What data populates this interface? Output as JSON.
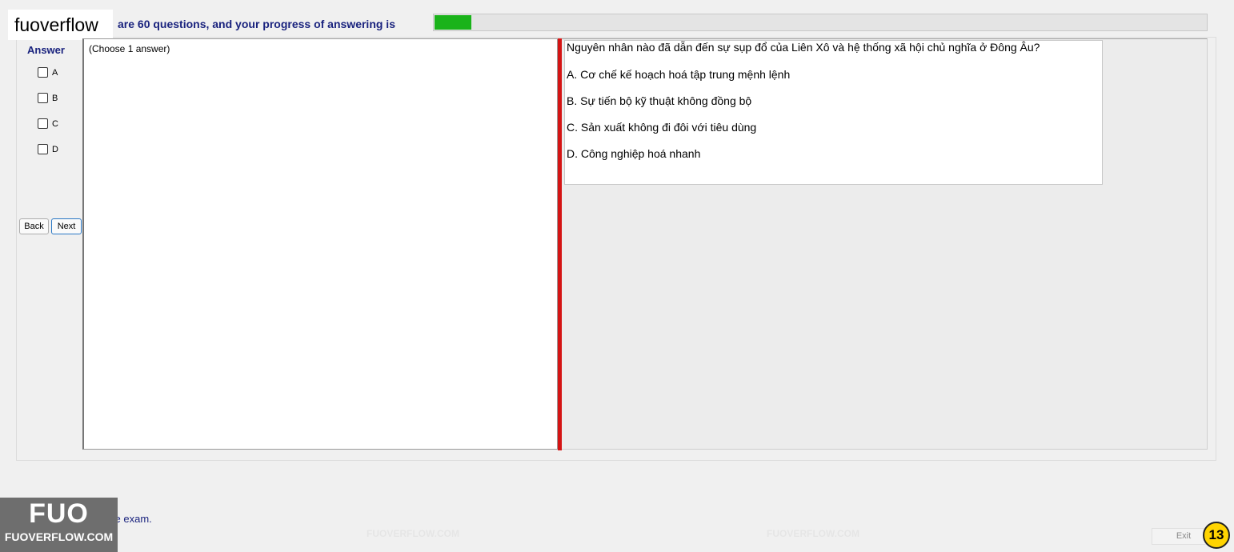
{
  "overlay": {
    "label": "fuoverflow"
  },
  "progress": {
    "text": "are 60 questions, and your progress of answering is",
    "percent": 4.8,
    "color": "#1ab31a"
  },
  "answer_panel": {
    "title": "Answer",
    "options": [
      "A",
      "B",
      "C",
      "D"
    ]
  },
  "nav": {
    "back_label": "Back",
    "next_label": "Next"
  },
  "instruction": "(Choose 1 answer)",
  "question": {
    "text": "Nguyên nhân nào đã dẫn đến sự sụp đổ của Liên Xô và hệ thống xã hội chủ nghĩa ở Đông Âu?",
    "options": [
      "A.  Cơ chế kế hoạch hoá tập trung mệnh lệnh",
      "B.  Sự tiến bộ kỹ thuật không đồng bộ",
      "C.  Sản xuất không đi đôi với tiêu dùng",
      "D.  Công nghiệp hoá nhanh"
    ]
  },
  "footer": {
    "finish_text": "I want to finish the exam.",
    "exit_label": "Exit",
    "page_number": "13"
  },
  "logo": {
    "big": "FUO",
    "small": "FUOVERFLOW.COM"
  },
  "watermark_text": "FUOVERFLOW.COM",
  "colors": {
    "divider": "#d41414",
    "accent": "#1a237e"
  }
}
